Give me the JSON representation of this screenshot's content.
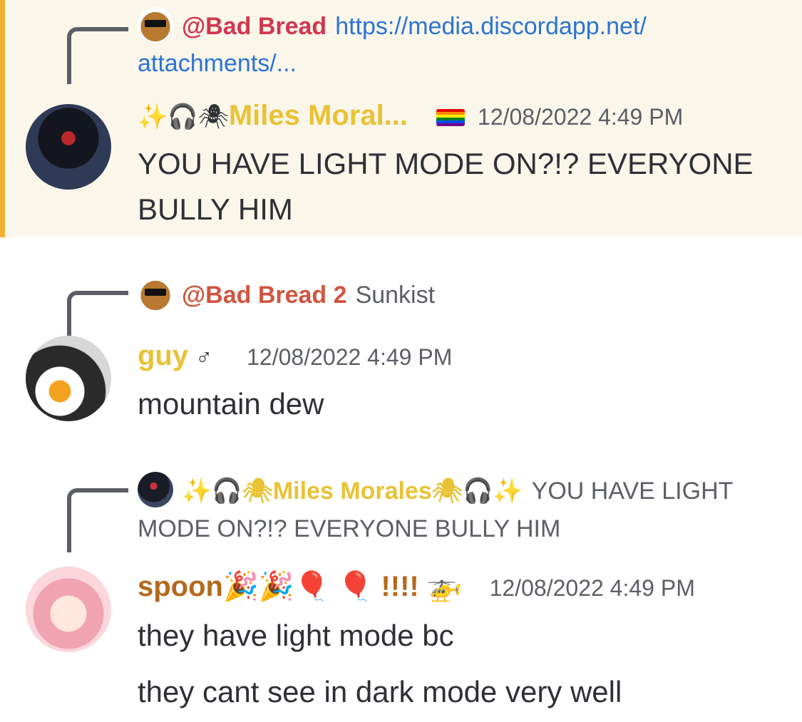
{
  "colors": {
    "highlight_bg": "#faf6ea",
    "highlight_bar": "#f0b232",
    "bad_bread": "#d1374f",
    "bad_bread_2": "#d0553f",
    "miles": "#e9c235",
    "guy": "#e9c235",
    "spoon": "#b4691d",
    "link": "#2b74d3",
    "timestamp": "#5c5e66"
  },
  "messages": [
    {
      "highlighted": true,
      "reply": {
        "avatar_icon": "bread-sunglasses-icon",
        "name": "@Bad Bread",
        "link": "https://media.discordapp.net/",
        "link_cont": "attachments/..."
      },
      "author": {
        "prefix": "✨🎧🕷",
        "name": "Miles Moral...",
        "badge_icon": "rainbow-flag-icon"
      },
      "timestamp": "12/08/2022 4:49 PM",
      "lines": [
        "YOU HAVE LIGHT MODE ON?!? EVERYONE BULLY HIM"
      ]
    },
    {
      "highlighted": false,
      "reply": {
        "avatar_icon": "bread-sunglasses-icon",
        "name": "@Bad Bread 2",
        "snippet": "Sunkist"
      },
      "author": {
        "name": "guy",
        "suffix": "♂"
      },
      "timestamp": "12/08/2022 4:49 PM",
      "lines": [
        "mountain dew"
      ]
    },
    {
      "highlighted": false,
      "reply": {
        "avatar_icon": "miles-avatar-icon",
        "name": "✨🎧🕷Miles Morales🕷🎧✨",
        "snippet": "YOU HAVE LIGHT MODE ON?!? EVERYONE BULLY HIM"
      },
      "author": {
        "name": "spoon🎉🎉🎈 🎈 !!!! 🚁"
      },
      "timestamp": "12/08/2022 4:49 PM",
      "lines": [
        "they have light mode bc",
        "they cant see in dark mode very well"
      ]
    }
  ]
}
